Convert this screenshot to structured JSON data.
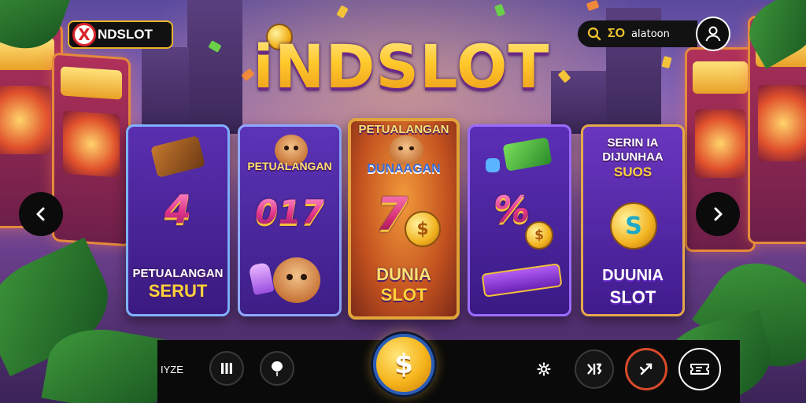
{
  "brand": {
    "name": "NDSLOT",
    "x_mark": "X"
  },
  "logo": {
    "text": "iNDSLOT"
  },
  "account": {
    "balance": "ΣO",
    "username": "alatoon"
  },
  "carousel": {
    "cards": [
      {
        "title": "",
        "number": "4",
        "bottom_line1": "PETUALANGAN",
        "bottom_line2": "SERUT"
      },
      {
        "title": "PETUALANGAN",
        "number": "017",
        "bottom_line1": "",
        "bottom_line2": ""
      },
      {
        "title": "PETUALANGAN",
        "subtitle": "DUNAAGAN",
        "number": "7",
        "coin_mark": "$",
        "bottom_line1": "DUNIA",
        "bottom_line2": "SLOT"
      },
      {
        "title": "",
        "number": "%",
        "coin_mark": "$",
        "bottom_line1": "",
        "bottom_line2": ""
      },
      {
        "title_line1": "SERIN IA",
        "title_line2": "DIJUNHAA",
        "title_line3": "SUOS",
        "coin_mark": "S",
        "bottom_line1": "DUUNIA",
        "bottom_line2": "SLOT"
      }
    ]
  },
  "bottom": {
    "bet_label": "IYZE",
    "spin_mark": "$"
  },
  "icons": {
    "prev": "chevron-left-icon",
    "next": "chevron-right-icon",
    "user": "user-icon",
    "search": "search-icon",
    "pause": "pause-icon",
    "balloon": "balloon-icon",
    "settings": "gear-icon",
    "stats": "stats-icon",
    "auto": "auto-spin-icon",
    "ticket": "ticket-icon"
  },
  "colors": {
    "gold": "#ffd43b",
    "accent_purple": "#5a2fb0",
    "spin_ring": "#2b5db8",
    "auto_ring": "#d94a2a"
  }
}
